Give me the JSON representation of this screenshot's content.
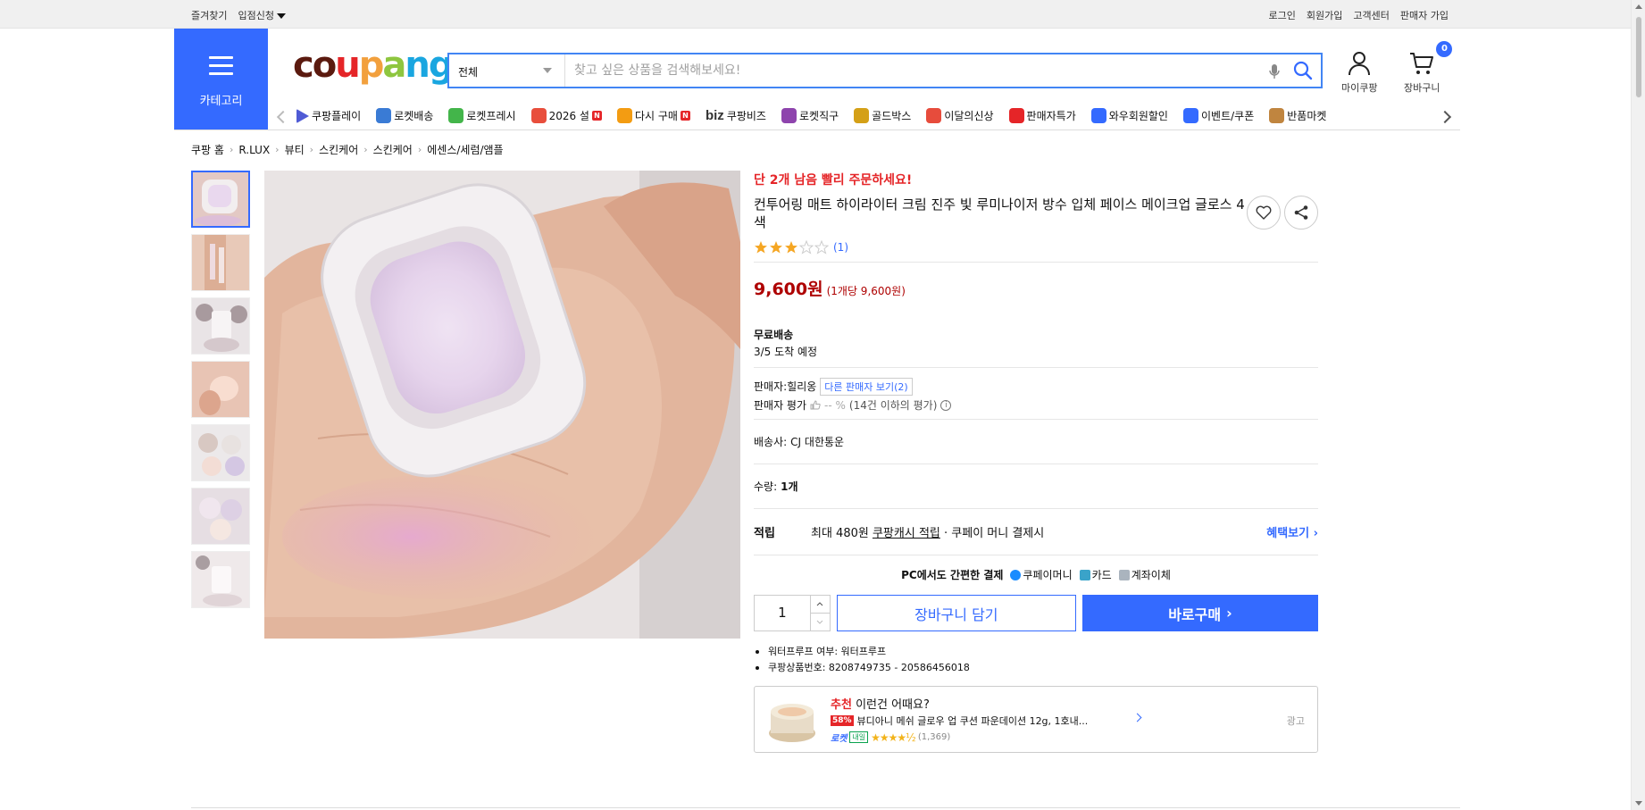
{
  "topbar": {
    "left": [
      "즐겨찾기",
      "입점신청"
    ],
    "right": [
      "로그인",
      "회원가입",
      "고객센터",
      "판매자 가입"
    ]
  },
  "header": {
    "category_label": "카테고리",
    "logo": [
      "c",
      "o",
      "u",
      "p",
      "a",
      "n",
      "g"
    ],
    "logo_colors": [
      "#5b1a0f",
      "#5b1a0f",
      "#e52528",
      "#f2a03d",
      "#8ec63f",
      "#1aa6e0",
      "#1aa6e0"
    ],
    "search": {
      "category": "전체",
      "placeholder": "찾고 싶은 상품을 검색해보세요!"
    },
    "my_label": "마이쿠팡",
    "cart_label": "장바구니",
    "cart_count": "0"
  },
  "nav": {
    "items": [
      {
        "label": "쿠팡플레이",
        "icon": "play-icon"
      },
      {
        "label": "로켓배송",
        "icon": "rocket-icon"
      },
      {
        "label": "로켓프레시",
        "icon": "rocket-fresh-icon"
      },
      {
        "label": "2026 설",
        "icon": "gift-icon",
        "badge": "N"
      },
      {
        "label": "다시 구매",
        "icon": "home-icon",
        "badge": "N"
      },
      {
        "label": "쿠팡비즈",
        "prefix": "biz"
      },
      {
        "label": "로켓직구",
        "icon": "globe-icon"
      },
      {
        "label": "골드박스",
        "icon": "goldbox-icon"
      },
      {
        "label": "이달의신상",
        "icon": "bag-icon"
      },
      {
        "label": "판매자특가",
        "icon": "percent-icon"
      },
      {
        "label": "와우회원할인",
        "icon": "wow-icon"
      },
      {
        "label": "이벤트/쿠폰",
        "icon": "coupon-icon"
      },
      {
        "label": "반품마켓",
        "icon": "market-icon"
      }
    ]
  },
  "breadcrumb": [
    "쿠팡 홈",
    "R.LUX",
    "뷰티",
    "스킨케어",
    "스킨케어",
    "에센스/세럼/앰플"
  ],
  "product": {
    "urgent": "단 2개 남음 빨리 주문하세요!",
    "title": "컨투어링 매트 하이라이터 크림 진주 빛 루미나이저 방수 입체 페이스 메이크업 글로스 4 색",
    "rating": 3,
    "rating_count": "(1)",
    "price": "9,600원",
    "unit_price": "(1개당 9,600원)",
    "shipping_label": "무료배송",
    "arrival": "3/5 도착 예정",
    "seller_label": "판매자:",
    "seller": "힐리옹",
    "other_sellers": "다른 판매자 보기(2)",
    "seller_rating_label": "판매자 평가",
    "seller_rating": "-- %",
    "seller_rating_note": "(14건 이하의 평가)",
    "carrier_label": "배송사:",
    "carrier": "CJ 대한통운",
    "qty_label": "수량:",
    "qty_value": "1개",
    "reward_label": "적립",
    "reward_text": "최대 480원",
    "reward_link": "쿠팡캐시 적립",
    "reward_suffix": "· 쿠페이 머니 결제시",
    "benefit": "혜택보기",
    "pay_title": "PC에서도 간편한 결제",
    "pay_methods": [
      "쿠페이머니",
      "카드",
      "계좌이체"
    ],
    "quantity": "1",
    "cart_button": "장바구니 담기",
    "buy_button": "바로구매",
    "bullets": [
      "워터프루프 여부: 워터프루프",
      "쿠팡상품번호: 8208749735 - 20586456018"
    ]
  },
  "reco": {
    "prefix": "추천",
    "title": "이런건 어때요?",
    "discount": "58%",
    "name": "뷰디아니 메쉬 글로우 업 쿠션 파운데이션 12g, 1호내...",
    "rocket": "로켓",
    "tomorrow": "내일",
    "stars": "★★★★½",
    "reviews": "(1,369)",
    "ad": "광고"
  },
  "colors": {
    "accent": "#346aff",
    "price": "#ae0000",
    "alert": "#e52528"
  }
}
